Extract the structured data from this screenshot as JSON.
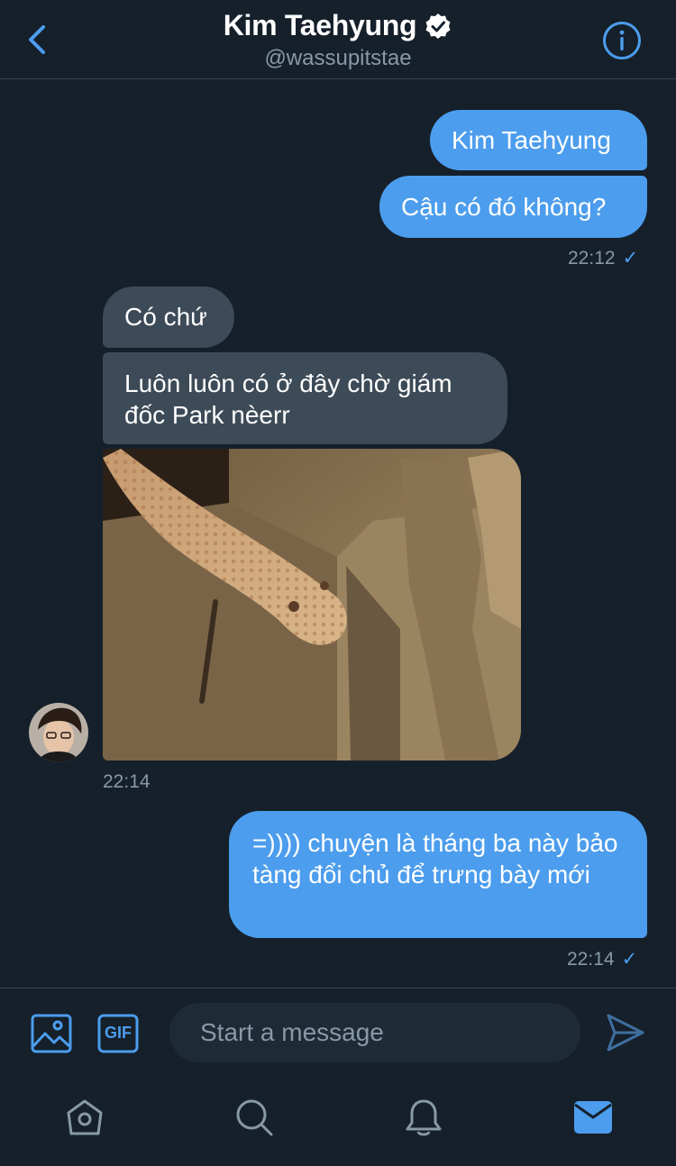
{
  "header": {
    "name": "Kim Taehyung",
    "handle": "@wassupitstae"
  },
  "messages": [
    {
      "direction": "outgoing",
      "text": "Kim Taehyung"
    },
    {
      "direction": "outgoing",
      "text": "Cậu có đó không?"
    },
    {
      "direction": "incoming",
      "text": "Có chứ"
    },
    {
      "direction": "incoming",
      "text": "Luôn luôn có ở đây chờ giám đốc Park nèerr"
    },
    {
      "direction": "outgoing",
      "text": "=)))) chuyện là tháng ba này bảo tàng đổi chủ để trưng bày mới"
    }
  ],
  "timestamps": {
    "t1": "22:12",
    "t2": "22:14",
    "t3": "22:14",
    "check": "✓"
  },
  "composer": {
    "placeholder": "Start a message",
    "gif_label": "GIF"
  },
  "icons": {
    "back": "chevron-left-icon",
    "verified": "verified-badge-icon",
    "info": "info-icon",
    "media": "image-icon",
    "gif": "gif-icon",
    "send": "send-icon",
    "home": "home-icon",
    "search": "search-icon",
    "notifications": "bell-icon",
    "messages": "mail-icon"
  },
  "colors": {
    "background": "#15202b",
    "accent": "#4c9ded",
    "incoming_bubble": "#3d4a57",
    "muted_text": "#8899a6"
  }
}
